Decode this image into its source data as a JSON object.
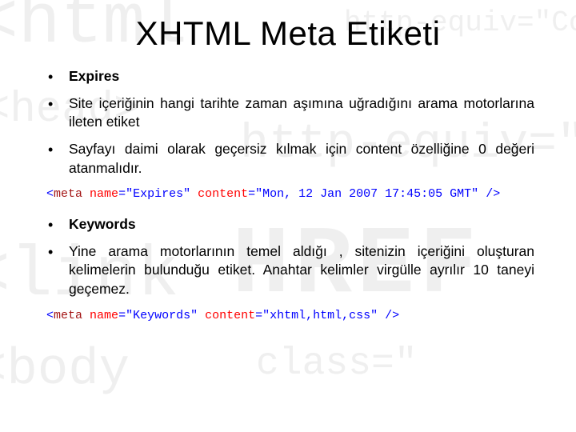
{
  "title": "XHTML Meta Etiketi",
  "bullets": {
    "b1": "Expires",
    "b2": "Site içeriğinin hangi tarihte zaman aşımına uğradığını arama motorlarına ileten etiket",
    "b3": "Sayfayı daimi olarak geçersiz kılmak için content özelliğine 0 değeri atanmalıdır.",
    "b4": "Keywords",
    "b5": "Yine arama motorlarının temel aldığı , sitenizin içeriğini oluşturan kelimelerin bulunduğu etiket. Anahtar kelimler virgülle ayrılır 10 taneyi geçemez."
  },
  "code1": {
    "open": "<",
    "tag": "meta",
    "sp1": " ",
    "attr1": "name",
    "eq": "=",
    "val1": "\"Expires\"",
    "sp2": " ",
    "attr2": "content",
    "val2": "\"Mon, 12 Jan 2007 17:45:05 GMT\"",
    "close": " />"
  },
  "code2": {
    "open": "<",
    "tag": "meta",
    "sp1": " ",
    "attr1": "name",
    "eq": "=",
    "val1": "\"Keywords\"",
    "sp2": " ",
    "attr2": "content",
    "val2": "\"xhtml,html,css\"",
    "close": " />"
  }
}
